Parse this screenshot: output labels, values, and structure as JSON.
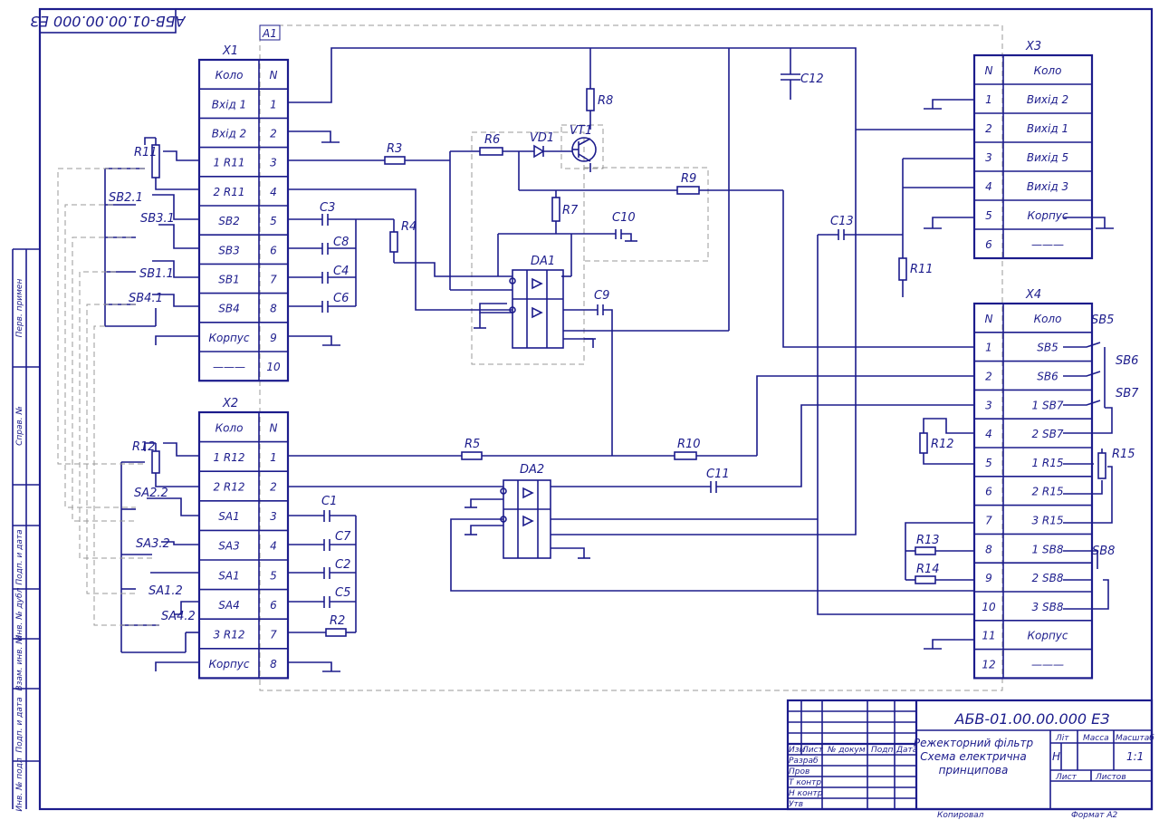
{
  "stamp_rotated": "АБВ-01.00.00.000 ЕЗ",
  "frame_label_a1": "A1",
  "x1": {
    "title": "X1",
    "head": [
      "Коло",
      "N"
    ],
    "rows": [
      [
        "Вхід 1",
        "1"
      ],
      [
        "Вхід 2",
        "2"
      ],
      [
        "1 R11",
        "3"
      ],
      [
        "2 R11",
        "4"
      ],
      [
        "SB2",
        "5"
      ],
      [
        "SB3",
        "6"
      ],
      [
        "SB1",
        "7"
      ],
      [
        "SB4",
        "8"
      ],
      [
        "Корпус",
        "9"
      ],
      [
        "———",
        "10"
      ]
    ]
  },
  "x2": {
    "title": "X2",
    "head": [
      "Коло",
      "N"
    ],
    "rows": [
      [
        "1 R12",
        "1"
      ],
      [
        "2 R12",
        "2"
      ],
      [
        "SA1",
        "3"
      ],
      [
        "SA3",
        "4"
      ],
      [
        "SA1",
        "5"
      ],
      [
        "SA4",
        "6"
      ],
      [
        "3 R12",
        "7"
      ],
      [
        "Корпус",
        "8"
      ]
    ]
  },
  "x3": {
    "title": "X3",
    "head": [
      "N",
      "Коло"
    ],
    "rows": [
      [
        "1",
        "Вихід 2"
      ],
      [
        "2",
        "Вихід 1"
      ],
      [
        "3",
        "Вихід 5"
      ],
      [
        "4",
        "Вихід 3"
      ],
      [
        "5",
        "Корпус"
      ],
      [
        "6",
        "———"
      ]
    ]
  },
  "x4": {
    "title": "X4",
    "head": [
      "N",
      "Коло"
    ],
    "rows": [
      [
        "1",
        "SB5"
      ],
      [
        "2",
        "SB6"
      ],
      [
        "3",
        "1 SB7"
      ],
      [
        "4",
        "2 SB7"
      ],
      [
        "5",
        "1 R15"
      ],
      [
        "6",
        "2 R15"
      ],
      [
        "7",
        "3 R15"
      ],
      [
        "8",
        "1 SB8"
      ],
      [
        "9",
        "2 SB8"
      ],
      [
        "10",
        "3 SB8"
      ],
      [
        "11",
        "Корпус"
      ],
      [
        "12",
        "———"
      ]
    ]
  },
  "components": {
    "r11": "R11",
    "r12": "R12",
    "r1_sb21": "SB2.1",
    "sb31": "SB3.1",
    "sb11": "SB1.1",
    "sb41": "SB4.1",
    "sa22": "SA2.2",
    "sa32": "SA3.2",
    "sa12": "SA1.2",
    "sa42": "SA4.2",
    "r3": "R3",
    "r4": "R4",
    "r5": "R5",
    "r6": "R6",
    "r7": "R7",
    "r8": "R8",
    "r9": "R9",
    "r10": "R10",
    "r2": "R2",
    "r11b": "R11",
    "r12b": "R12",
    "r13": "R13",
    "r14": "R14",
    "r15": "R15",
    "c1": "C1",
    "c2": "C2",
    "c3": "C3",
    "c4": "C4",
    "c5": "C5",
    "c6": "C6",
    "c7": "C7",
    "c8": "C8",
    "c9": "C9",
    "c10": "C10",
    "c11": "C11",
    "c12": "C12",
    "c13": "C13",
    "vd1": "VD1",
    "vt1": "VT1",
    "da1": "DA1",
    "da2": "DA2",
    "sb5": "SB5",
    "sb6": "SB6",
    "sb7": "SB7",
    "sb8": "SB8"
  },
  "title_block": {
    "doc_code": "АБВ-01.00.00.000 ЕЗ",
    "name_lines": [
      "Режекторний фільтр",
      "Схема електрична",
      "принципова"
    ],
    "lit_head": "Літ",
    "mass_head": "Масса",
    "scale_head": "Масштаб",
    "lit_value": "Н",
    "scale_value": "1:1",
    "sheet_label": "Лист",
    "sheets_label": "Листов",
    "col_heads": [
      "Изм",
      "Лист",
      "№ докум",
      "Подп",
      "Дата"
    ],
    "roles": [
      "Разраб",
      "Пров",
      "Т контр",
      "Н контр",
      "Утв"
    ],
    "copied": "Копировал",
    "format": "Формат    А2"
  },
  "side_strip": [
    "Перв. примен",
    "Справ. №",
    "Подп. и дата",
    "Инв. № дубл",
    "Взам. инв. №",
    "Подп. и дата",
    "Инв. № подл"
  ]
}
